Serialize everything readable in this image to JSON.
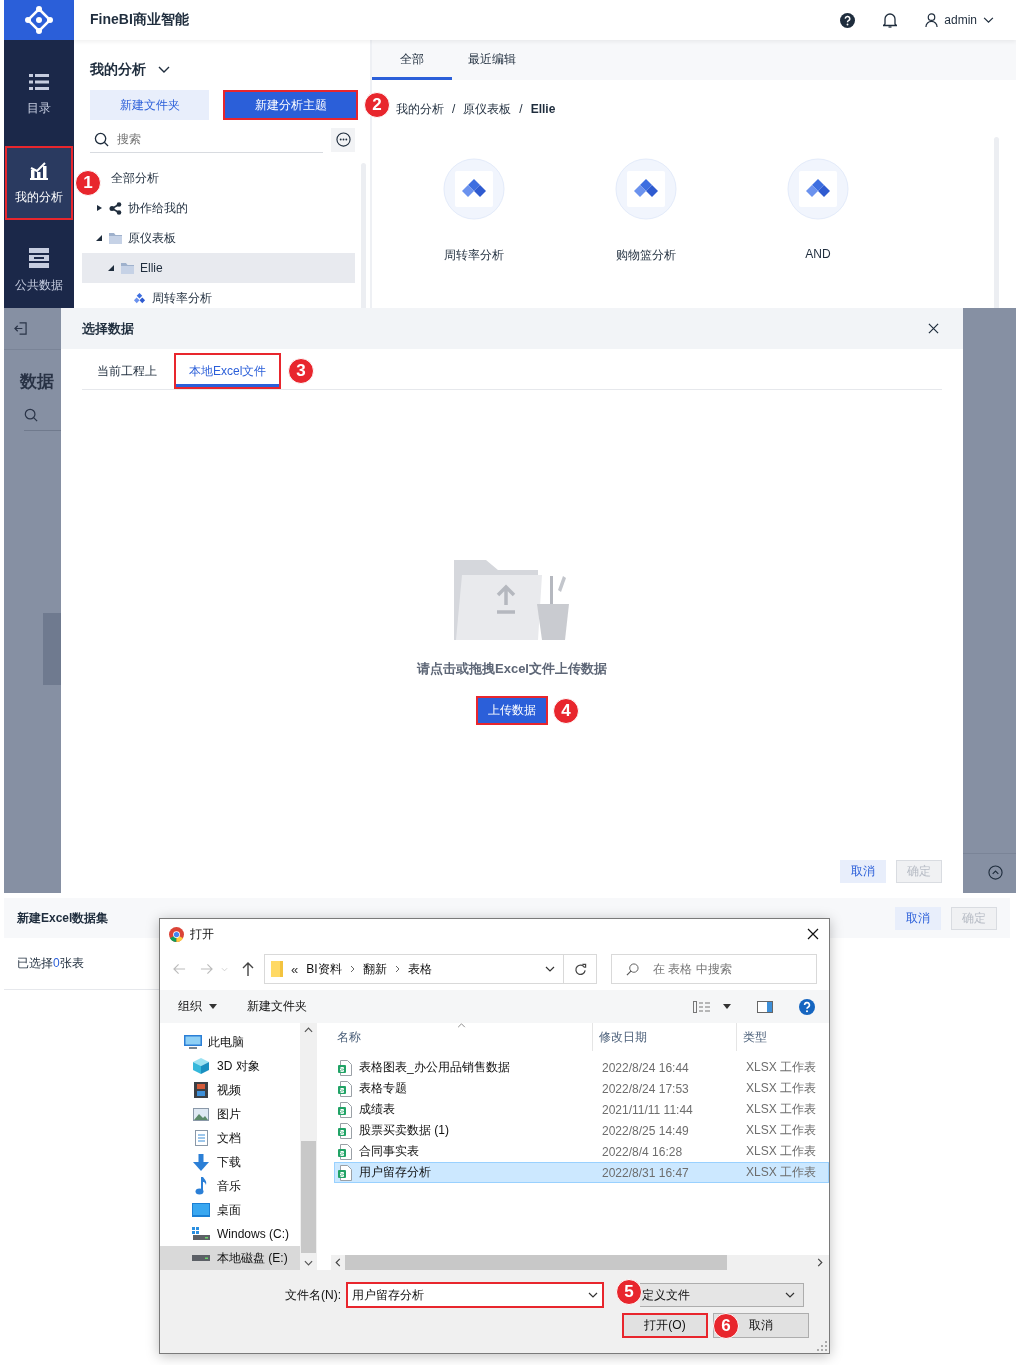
{
  "top_screen": {
    "app_title": "FineBI商业智能",
    "user": "admin",
    "nav": [
      {
        "label": "目录",
        "selected": false,
        "highlighted": false
      },
      {
        "label": "我的分析",
        "selected": true,
        "highlighted": true,
        "callout": "1"
      },
      {
        "label": "公共数据",
        "selected": false,
        "highlighted": false
      }
    ],
    "section_title": "我的分析",
    "actions": [
      {
        "label": "新建文件夹",
        "kind": "secondary",
        "highlighted": false
      },
      {
        "label": "新建分析主题",
        "kind": "primary",
        "highlighted": true,
        "callout": "2"
      }
    ],
    "search": {
      "placeholder": "搜索"
    },
    "tree": [
      {
        "label": "全部分析",
        "selected": false,
        "children": [
          {
            "label": "协作给我的",
            "kind": "shared",
            "expanded": false,
            "selected": false
          },
          {
            "label": "原仪表板",
            "kind": "folder",
            "expanded": true,
            "selected": false,
            "children": [
              {
                "label": "Ellie",
                "kind": "folder",
                "expanded": true,
                "selected": true,
                "children": [
                  {
                    "label": "周转率分析",
                    "kind": "analysis",
                    "selected": false
                  }
                ]
              }
            ]
          }
        ]
      }
    ],
    "tabs": [
      {
        "label": "全部",
        "selected": true
      },
      {
        "label": "最近编辑",
        "selected": false
      }
    ],
    "breadcrumb": [
      {
        "text": "我的分析",
        "kind": "crumb"
      },
      {
        "text": "/",
        "kind": "separator"
      },
      {
        "text": "原仪表板",
        "kind": "crumb"
      },
      {
        "text": "/",
        "kind": "separator"
      },
      {
        "text": "Ellie",
        "kind": "current"
      }
    ],
    "cards": [
      "周转率分析",
      "购物篮分析",
      "AND"
    ]
  },
  "middle_screen": {
    "background": {
      "heading": "数据"
    },
    "dialog": {
      "title": "选择数据",
      "tabs": [
        {
          "label": "当前工程上",
          "selected": false,
          "highlighted": false
        },
        {
          "label": "本地Excel文件",
          "selected": true,
          "highlighted": true,
          "callout": "3"
        }
      ],
      "hint": "请点击或拖拽Excel文件上传数据",
      "upload_button": {
        "label": "上传数据",
        "highlighted": true,
        "callout": "4"
      },
      "footer_buttons": [
        {
          "label": "取消",
          "disabled": false
        },
        {
          "label": "确定",
          "disabled": true
        }
      ]
    }
  },
  "bottom_screen": {
    "background": {
      "title": "新建Excel数据集",
      "selection": {
        "prefix": "已选择",
        "count": "0",
        "suffix": "张表"
      },
      "buttons": [
        {
          "label": "取消",
          "disabled": false
        },
        {
          "label": "确定",
          "disabled": true
        }
      ]
    },
    "file_dialog": {
      "title": "打开",
      "path_overflow": "«",
      "path": [
        "BI资料",
        "翻新",
        "表格"
      ],
      "search": {
        "placeholder": "在 表格 中搜索"
      },
      "toolbar": [
        {
          "label": "组织",
          "kind": "menu"
        },
        {
          "label": "新建文件夹",
          "kind": "button"
        }
      ],
      "nav": [
        {
          "label": "此电脑",
          "kind": "computer",
          "selected": false,
          "children": [
            {
              "label": "3D 对象",
              "kind": "objects",
              "selected": false
            },
            {
              "label": "视频",
              "kind": "videos",
              "selected": false
            },
            {
              "label": "图片",
              "kind": "pictures",
              "selected": false
            },
            {
              "label": "文档",
              "kind": "documents",
              "selected": false
            },
            {
              "label": "下载",
              "kind": "downloads",
              "selected": false
            },
            {
              "label": "音乐",
              "kind": "music",
              "selected": false
            },
            {
              "label": "桌面",
              "kind": "desktop",
              "selected": false
            },
            {
              "label": "Windows (C:)",
              "kind": "system",
              "selected": false
            },
            {
              "label": "本地磁盘 (E:)",
              "kind": "disk",
              "selected": true
            }
          ]
        }
      ],
      "columns": [
        "名称",
        "修改日期",
        "类型"
      ],
      "files": [
        {
          "name": "表格图表_办公用品销售数据",
          "modified": "2022/8/24 16:44",
          "type": "XLSX 工作表",
          "selected": false
        },
        {
          "name": "表格专题",
          "modified": "2022/8/24 17:53",
          "type": "XLSX 工作表",
          "selected": false
        },
        {
          "name": "成绩表",
          "modified": "2021/11/11 11:44",
          "type": "XLSX 工作表",
          "selected": false
        },
        {
          "name": "股票买卖数据 (1)",
          "modified": "2022/8/25 14:49",
          "type": "XLSX 工作表",
          "selected": false
        },
        {
          "name": "合同事实表",
          "modified": "2022/8/4 16:28",
          "type": "XLSX 工作表",
          "selected": false
        },
        {
          "name": "用户留存分析",
          "modified": "2022/8/31 16:47",
          "type": "XLSX 工作表",
          "selected": true
        }
      ],
      "filename": {
        "label": "文件名(N):",
        "value": "用户留存分析",
        "highlighted": true,
        "callout": "5"
      },
      "filetype": {
        "value": "定义文件"
      },
      "buttons": [
        {
          "label": "打开(O)",
          "kind": "primary",
          "highlighted": true,
          "callout": "6"
        },
        {
          "label": "取消",
          "kind": "normal",
          "highlighted": false
        }
      ]
    }
  }
}
